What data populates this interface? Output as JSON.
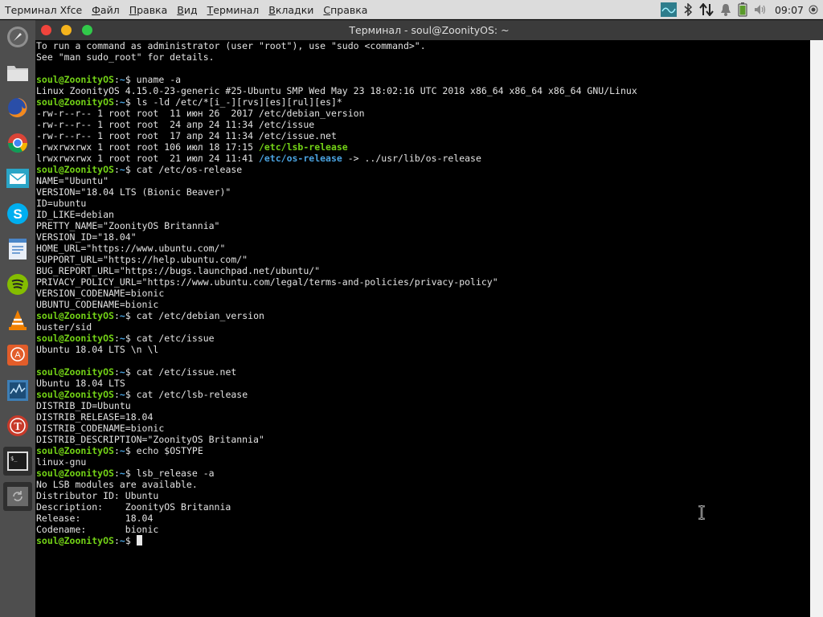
{
  "top_panel": {
    "menu": [
      "Терминал Xfce",
      "Файл",
      "Правка",
      "Вид",
      "Терминал",
      "Вкладки",
      "Справка"
    ],
    "tray_icons": [
      "network-monitor-icon",
      "bluetooth-icon",
      "network-transfer-icon",
      "notification-bell-icon",
      "battery-icon",
      "volume-icon"
    ],
    "clock": "09:07",
    "power_icon": "power-icon"
  },
  "dock": {
    "items": [
      "rocket-launcher-icon",
      "files-icon",
      "firefox-icon",
      "chrome-icon",
      "mail-icon",
      "skype-icon",
      "text-editor-icon",
      "spotify-icon",
      "vlc-icon",
      "software-center-icon",
      "system-monitor-icon",
      "app-red-icon",
      "terminal-icon",
      "refresh-icon"
    ]
  },
  "window": {
    "title": "Терминал - soul@ZoonityOS: ~"
  },
  "prompt": {
    "user_host": "soul@ZoonityOS",
    "path": "~",
    "symbol": "$"
  },
  "terminal_lines": [
    {
      "text": "To run a command as administrator (user \"root\"), use \"sudo <command>\"."
    },
    {
      "text": "See \"man sudo_root\" for details."
    },
    {
      "text": ""
    },
    {
      "prompt": true,
      "cmd": "uname -a"
    },
    {
      "text": "Linux ZoonityOS 4.15.0-23-generic #25-Ubuntu SMP Wed May 23 18:02:16 UTC 2018 x86_64 x86_64 x86_64 GNU/Linux"
    },
    {
      "prompt": true,
      "cmd": "ls -ld /etc/*[i_-][rvs][es][rul][es]*"
    },
    {
      "text": "-rw-r--r-- 1 root root  11 июн 26  2017 /etc/debian_version"
    },
    {
      "text": "-rw-r--r-- 1 root root  24 апр 24 11:34 /etc/issue"
    },
    {
      "text": "-rw-r--r-- 1 root root  17 апр 24 11:34 /etc/issue.net"
    },
    {
      "text": "-rwxrwxrwx 1 root root 106 июл 18 17:15 ",
      "hl": "/etc/lsb-release",
      "hl_class": "g"
    },
    {
      "text": "lrwxrwxrwx 1 root root  21 июл 24 11:41 ",
      "hl": "/etc/os-release",
      "hl_class": "b",
      "tail": " -> ../usr/lib/os-release"
    },
    {
      "prompt": true,
      "cmd": "cat /etc/os-release"
    },
    {
      "text": "NAME=\"Ubuntu\""
    },
    {
      "text": "VERSION=\"18.04 LTS (Bionic Beaver)\""
    },
    {
      "text": "ID=ubuntu"
    },
    {
      "text": "ID_LIKE=debian"
    },
    {
      "text": "PRETTY_NAME=\"ZoonityOS Britannia\""
    },
    {
      "text": "VERSION_ID=\"18.04\""
    },
    {
      "text": "HOME_URL=\"https://www.ubuntu.com/\""
    },
    {
      "text": "SUPPORT_URL=\"https://help.ubuntu.com/\""
    },
    {
      "text": "BUG_REPORT_URL=\"https://bugs.launchpad.net/ubuntu/\""
    },
    {
      "text": "PRIVACY_POLICY_URL=\"https://www.ubuntu.com/legal/terms-and-policies/privacy-policy\""
    },
    {
      "text": "VERSION_CODENAME=bionic"
    },
    {
      "text": "UBUNTU_CODENAME=bionic"
    },
    {
      "prompt": true,
      "cmd": "cat /etc/debian_version"
    },
    {
      "text": "buster/sid"
    },
    {
      "prompt": true,
      "cmd": "cat /etc/issue"
    },
    {
      "text": "Ubuntu 18.04 LTS \\n \\l"
    },
    {
      "text": ""
    },
    {
      "prompt": true,
      "cmd": "cat /etc/issue.net"
    },
    {
      "text": "Ubuntu 18.04 LTS"
    },
    {
      "prompt": true,
      "cmd": "cat /etc/lsb-release"
    },
    {
      "text": "DISTRIB_ID=Ubuntu"
    },
    {
      "text": "DISTRIB_RELEASE=18.04"
    },
    {
      "text": "DISTRIB_CODENAME=bionic"
    },
    {
      "text": "DISTRIB_DESCRIPTION=\"ZoonityOS Britannia\""
    },
    {
      "prompt": true,
      "cmd": "echo $OSTYPE"
    },
    {
      "text": "linux-gnu"
    },
    {
      "prompt": true,
      "cmd": "lsb_release -a"
    },
    {
      "text": "No LSB modules are available."
    },
    {
      "text": "Distributor ID:\tUbuntu"
    },
    {
      "text": "Description:\tZoonityOS Britannia"
    },
    {
      "text": "Release:\t18.04"
    },
    {
      "text": "Codename:\tbionic"
    },
    {
      "prompt": true,
      "cmd": "",
      "cursor": true
    }
  ]
}
